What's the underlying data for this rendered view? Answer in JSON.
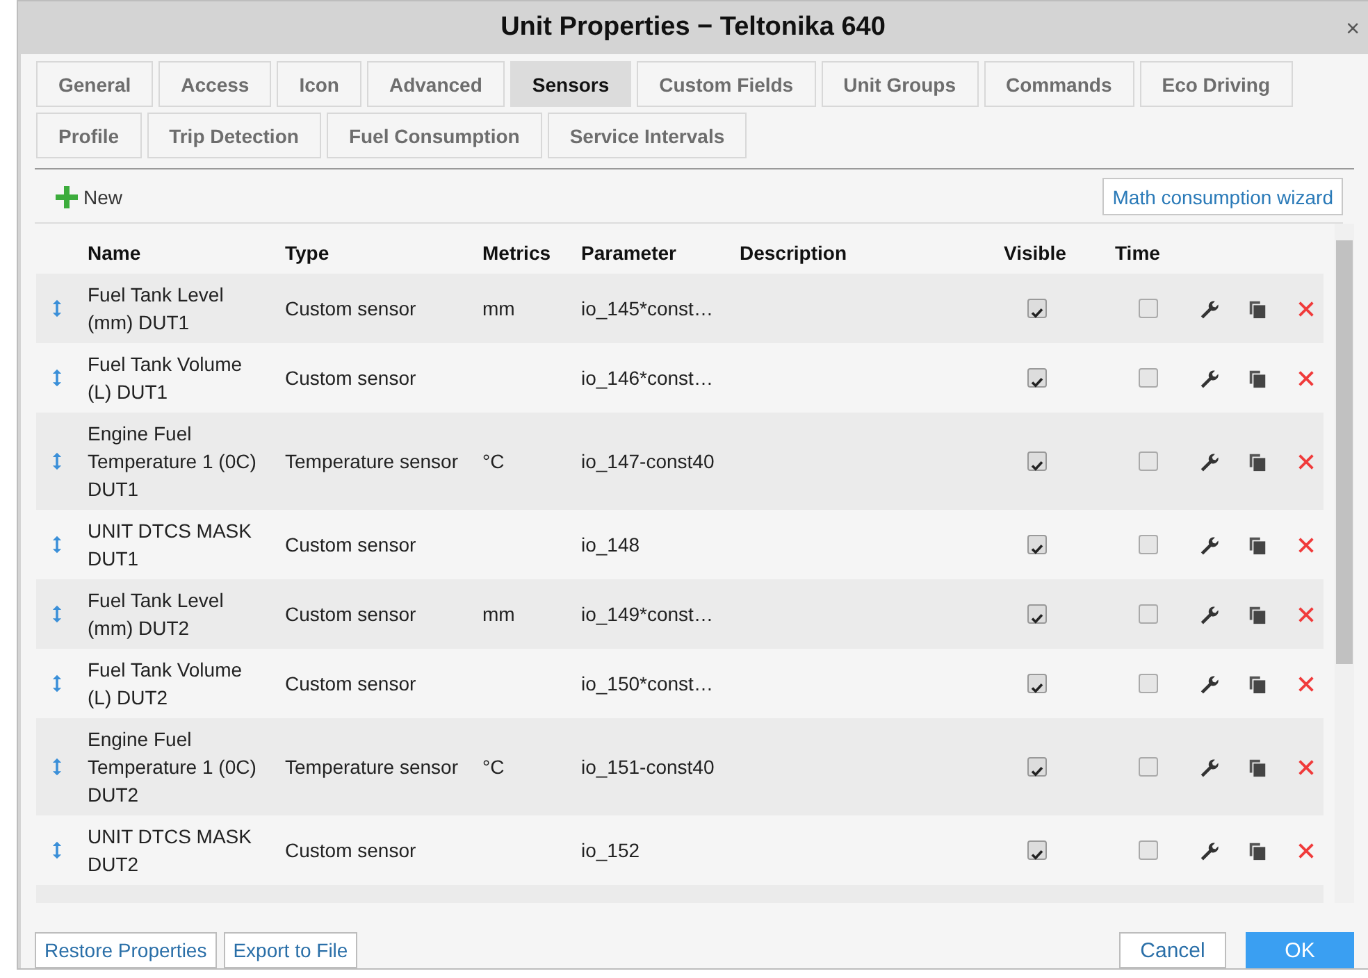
{
  "window": {
    "title": "Unit Properties − Teltonika 640",
    "close": "×"
  },
  "tabs": [
    [
      {
        "label": "General",
        "selected": false
      },
      {
        "label": "Access",
        "selected": false
      },
      {
        "label": "Icon",
        "selected": false
      },
      {
        "label": "Advanced",
        "selected": false
      },
      {
        "label": "Sensors",
        "selected": true
      },
      {
        "label": "Custom Fields",
        "selected": false
      },
      {
        "label": "Unit Groups",
        "selected": false
      },
      {
        "label": "Commands",
        "selected": false
      },
      {
        "label": "Eco Driving",
        "selected": false
      }
    ],
    [
      {
        "label": "Profile",
        "selected": false
      },
      {
        "label": "Trip Detection",
        "selected": false
      },
      {
        "label": "Fuel Consumption",
        "selected": false
      },
      {
        "label": "Service Intervals",
        "selected": false
      }
    ]
  ],
  "toolbar": {
    "new_button": "New",
    "wizard_button": "Math consumption wizard"
  },
  "table": {
    "columns": [
      "Name",
      "Type",
      "Metrics",
      "Parameter",
      "Description",
      "Visible",
      "Time"
    ],
    "rows": [
      {
        "name": "Fuel Tank Level (mm) DUT1",
        "type": "Custom sensor",
        "metrics": "mm",
        "parameter": "io_145*const…",
        "visible": true,
        "time": false
      },
      {
        "name": "Fuel Tank Volume (L) DUT1",
        "type": "Custom sensor",
        "metrics": "",
        "parameter": "io_146*const…",
        "visible": true,
        "time": false
      },
      {
        "name": "Engine Fuel Temperature 1 (0C) DUT1",
        "type": "Temperature sensor",
        "metrics": "°C",
        "parameter": "io_147-const40",
        "visible": true,
        "time": false
      },
      {
        "name": "UNIT DTCS MASK DUT1",
        "type": "Custom sensor",
        "metrics": "",
        "parameter": "io_148",
        "visible": true,
        "time": false
      },
      {
        "name": "Fuel Tank Level (mm) DUT2",
        "type": "Custom sensor",
        "metrics": "mm",
        "parameter": "io_149*const…",
        "visible": true,
        "time": false
      },
      {
        "name": "Fuel Tank Volume (L) DUT2",
        "type": "Custom sensor",
        "metrics": "",
        "parameter": "io_150*const…",
        "visible": true,
        "time": false
      },
      {
        "name": "Engine Fuel Temperature 1 (0C) DUT2",
        "type": "Temperature sensor",
        "metrics": "°C",
        "parameter": "io_151-const40",
        "visible": true,
        "time": false
      },
      {
        "name": "UNIT DTCS MASK DUT2",
        "type": "Custom sensor",
        "metrics": "",
        "parameter": "io_152",
        "visible": true,
        "time": false
      }
    ]
  },
  "footer": {
    "left_buttons": [
      "Restore Properties",
      "Export to File"
    ],
    "cancel": "Cancel",
    "ok": "OK"
  }
}
